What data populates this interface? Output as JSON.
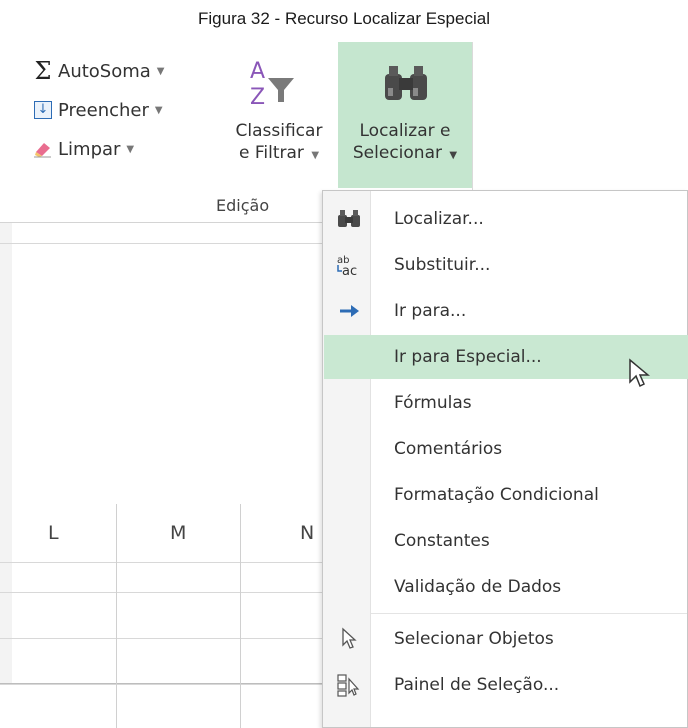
{
  "caption": "Figura 32 - Recurso Localizar Especial",
  "ribbon": {
    "autosoma": "AutoSoma",
    "preencher": "Preencher",
    "limpar": "Limpar",
    "classificar_line1": "Classificar",
    "classificar_line2": "e Filtrar",
    "localizar_line1": "Localizar e",
    "localizar_line2": "Selecionar",
    "group_label": "Edição",
    "sigma_glyph": "Σ"
  },
  "grid": {
    "columns": [
      "L",
      "M",
      "N"
    ]
  },
  "menu": {
    "items": [
      {
        "label": "Localizar...",
        "icon": "binoculars-icon"
      },
      {
        "label": "Substituir...",
        "icon": "replace-icon"
      },
      {
        "label": "Ir para...",
        "icon": "arrow-right-icon"
      },
      {
        "label": "Ir para Especial...",
        "icon": "none",
        "highlighted": true
      },
      {
        "label": "Fórmulas",
        "icon": "none"
      },
      {
        "label": "Comentários",
        "icon": "none"
      },
      {
        "label": "Formatação Condicional",
        "icon": "none"
      },
      {
        "label": "Constantes",
        "icon": "none"
      },
      {
        "label": "Validação de Dados",
        "icon": "none"
      },
      {
        "label": "Selecionar Objetos",
        "icon": "pointer-icon"
      },
      {
        "label": "Painel de Seleção...",
        "icon": "selection-pane-icon"
      }
    ]
  },
  "colors": {
    "highlight": "#c9e8d2",
    "ribbon_active": "#c5e6cf",
    "arrow_blue": "#2d6cb5"
  }
}
